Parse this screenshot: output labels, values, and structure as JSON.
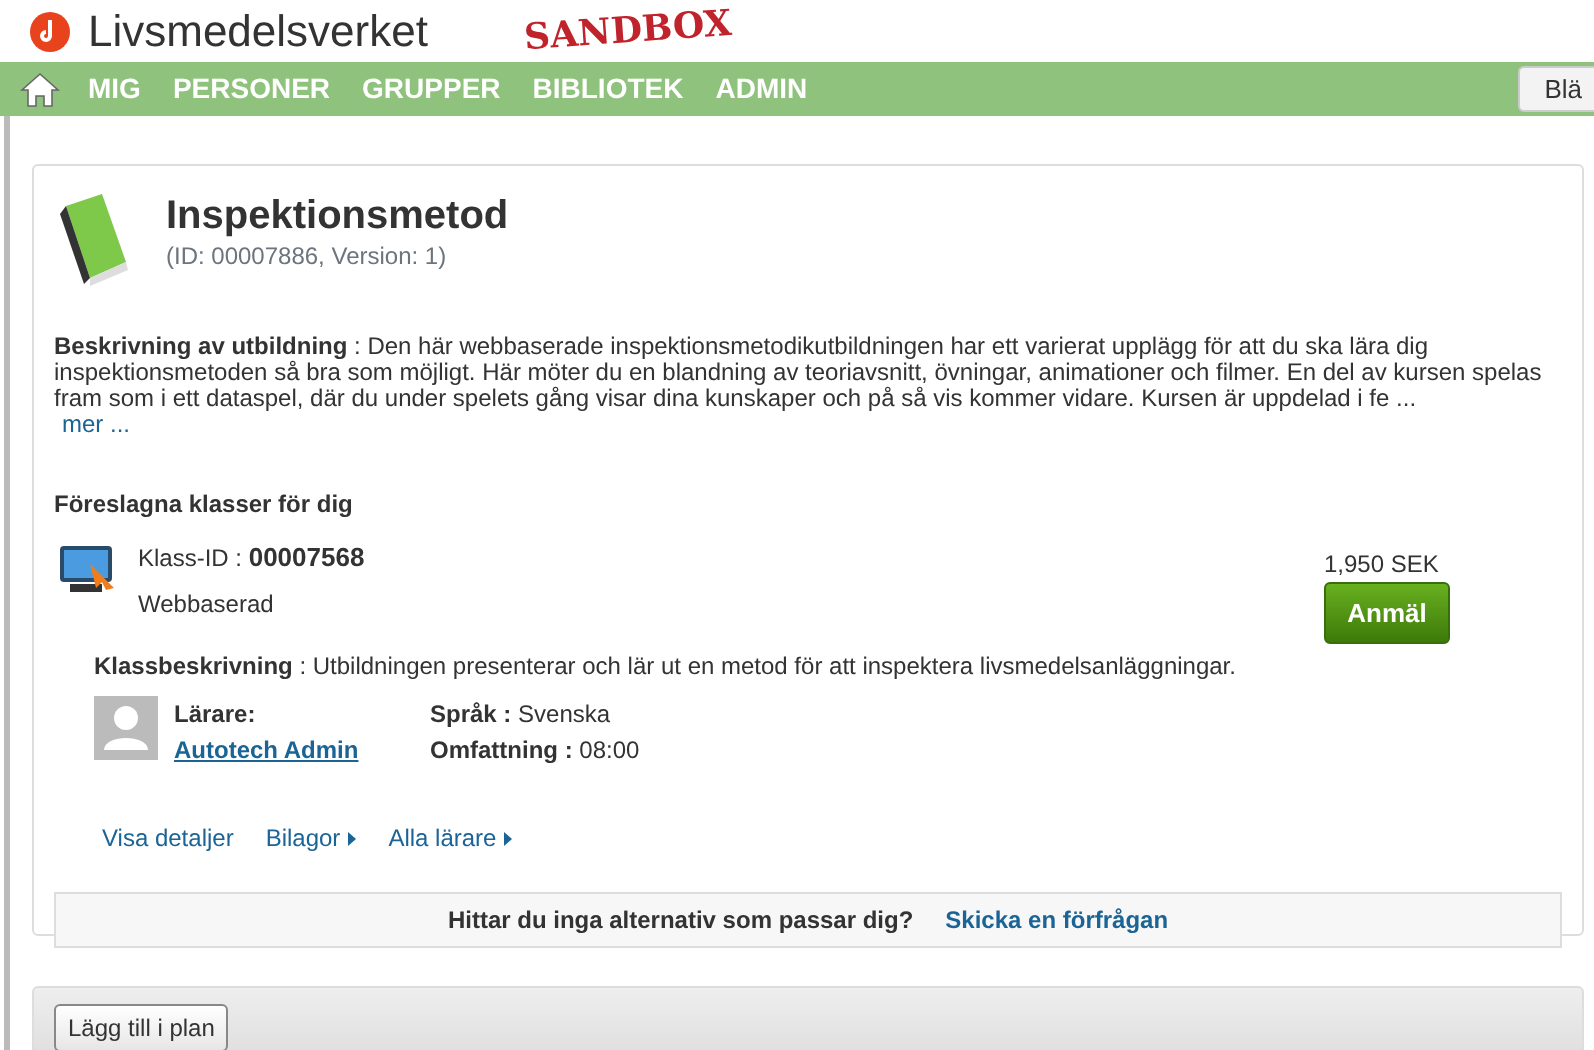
{
  "header": {
    "logo": "Livsmedelsverket",
    "badge": "SANDBOX"
  },
  "nav": {
    "items": [
      {
        "label": "MIG"
      },
      {
        "label": "PERSONER"
      },
      {
        "label": "GRUPPER"
      },
      {
        "label": "BIBLIOTEK"
      },
      {
        "label": "ADMIN"
      }
    ],
    "side_button": "Blä"
  },
  "course": {
    "title": "Inspektionsmetod",
    "id_line": "(ID: 00007886, Version: 1)",
    "description": "**Beskrivning av utbildning** : Den här webbaserade inspektionsmetodikutbildningen har ett varierat upplägg för att du ska lära dig inspektionsmetoden så bra som möjligt. Här möter du en blandning av teoriavsnitt, övningar, animationer och filmer. En del av kursen spelas fram som i ett dataspel, där du under spelets gång visar dina kunskaper och på så vis kommer vidare. Kursen är uppdelad i fe ...",
    "more": "mer ..."
  },
  "classes": {
    "heading": "Föreslagna klasser för dig",
    "items": [
      {
        "class_id_label": "Klass-ID :",
        "class_id": "00007568",
        "type": "Webbaserad",
        "price": "1,950 SEK",
        "enroll": "Anmäl",
        "description": "**Klassbeskrivning** : Utbildningen presenterar och lär ut en metod för att inspektera livsmedelsanläggningar.",
        "teacher_label": "Lärare:",
        "teacher": "Autotech Admin",
        "language": "**Språk :** Svenska",
        "duration": "**Omfattning :** 08:00",
        "links": [
          {
            "label": "Visa detaljer",
            "kind": "plain"
          },
          {
            "label": "Bilagor",
            "kind": "menu"
          },
          {
            "label": "Alla lärare",
            "kind": "menu"
          }
        ]
      }
    ]
  },
  "request": {
    "question": "Hittar du inga alternativ som passar dig?",
    "link": "Skicka en förfrågan"
  },
  "footer": {
    "button": "Lägg till i plan"
  }
}
